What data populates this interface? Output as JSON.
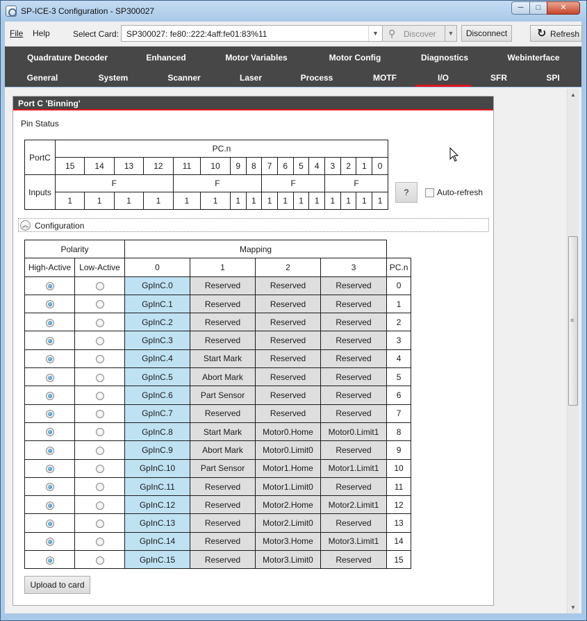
{
  "window": {
    "title": "SP-ICE-3 Configuration - SP300027",
    "minimize": "─",
    "maximize": "□",
    "close": "✕"
  },
  "menu": {
    "file": "File",
    "help": "Help"
  },
  "toolbar": {
    "select_card_label": "Select Card:",
    "card_value": "SP300027: fe80::222:4aff:fe01:83%11",
    "discover_label": "Discover",
    "disconnect_label": "Disconnect",
    "refresh_label": "Refresh"
  },
  "tabs_row1": [
    "Quadrature Decoder",
    "Enhanced",
    "Motor Variables",
    "Motor Config",
    "Diagnostics",
    "Webinterface"
  ],
  "tabs_row2": [
    "General",
    "System",
    "Scanner",
    "Laser",
    "Process",
    "MOTF",
    "I/O",
    "SFR",
    "SPI"
  ],
  "active_tab": "I/O",
  "panel": {
    "title": "Port C 'Binning'",
    "pin_status_label": "Pin Status",
    "pin_table": {
      "port_label": "PortC",
      "pc_header": "PC.n",
      "pin_numbers": [
        "15",
        "14",
        "13",
        "12",
        "11",
        "10",
        "9",
        "8",
        "7",
        "6",
        "5",
        "4",
        "3",
        "2",
        "1",
        "0"
      ],
      "inputs_label": "Inputs",
      "hex_groups": [
        "F",
        "F",
        "F",
        "F"
      ],
      "input_values": [
        "1",
        "1",
        "1",
        "1",
        "1",
        "1",
        "1",
        "1",
        "1",
        "1",
        "1",
        "1",
        "1",
        "1",
        "1",
        "1"
      ]
    },
    "help_button": "?",
    "auto_refresh_label": "Auto-refresh",
    "auto_refresh_checked": false,
    "configuration_label": "Configuration",
    "mapping_table": {
      "polarity_header": "Polarity",
      "mapping_header": "Mapping",
      "high_active": "High-Active",
      "low_active": "Low-Active",
      "map_columns": [
        "0",
        "1",
        "2",
        "3"
      ],
      "pc_header": "PC.n",
      "rows": [
        {
          "high": true,
          "m0": "GpInC.0",
          "m1": "Reserved",
          "m2": "Reserved",
          "m3": "Reserved",
          "pc": "0"
        },
        {
          "high": true,
          "m0": "GpInC.1",
          "m1": "Reserved",
          "m2": "Reserved",
          "m3": "Reserved",
          "pc": "1"
        },
        {
          "high": true,
          "m0": "GpInC.2",
          "m1": "Reserved",
          "m2": "Reserved",
          "m3": "Reserved",
          "pc": "2"
        },
        {
          "high": true,
          "m0": "GpInC.3",
          "m1": "Reserved",
          "m2": "Reserved",
          "m3": "Reserved",
          "pc": "3"
        },
        {
          "high": true,
          "m0": "GpInC.4",
          "m1": "Start Mark",
          "m2": "Reserved",
          "m3": "Reserved",
          "pc": "4"
        },
        {
          "high": true,
          "m0": "GpInC.5",
          "m1": "Abort Mark",
          "m2": "Reserved",
          "m3": "Reserved",
          "pc": "5"
        },
        {
          "high": true,
          "m0": "GpInC.6",
          "m1": "Part Sensor",
          "m2": "Reserved",
          "m3": "Reserved",
          "pc": "6"
        },
        {
          "high": true,
          "m0": "GpInC.7",
          "m1": "Reserved",
          "m2": "Reserved",
          "m3": "Reserved",
          "pc": "7"
        },
        {
          "high": true,
          "m0": "GpInC.8",
          "m1": "Start Mark",
          "m2": "Motor0.Home",
          "m3": "Motor0.Limit1",
          "pc": "8"
        },
        {
          "high": true,
          "m0": "GpInC.9",
          "m1": "Abort Mark",
          "m2": "Motor0.Limit0",
          "m3": "Reserved",
          "pc": "9"
        },
        {
          "high": true,
          "m0": "GpInC.10",
          "m1": "Part Sensor",
          "m2": "Motor1.Home",
          "m3": "Motor1.Limit1",
          "pc": "10"
        },
        {
          "high": true,
          "m0": "GpInC.11",
          "m1": "Reserved",
          "m2": "Motor1.Limit0",
          "m3": "Reserved",
          "pc": "11"
        },
        {
          "high": true,
          "m0": "GpInC.12",
          "m1": "Reserved",
          "m2": "Motor2.Home",
          "m3": "Motor2.Limit1",
          "pc": "12"
        },
        {
          "high": true,
          "m0": "GpInC.13",
          "m1": "Reserved",
          "m2": "Motor2.Limit0",
          "m3": "Reserved",
          "pc": "13"
        },
        {
          "high": true,
          "m0": "GpInC.14",
          "m1": "Reserved",
          "m2": "Motor3.Home",
          "m3": "Motor3.Limit1",
          "pc": "14"
        },
        {
          "high": true,
          "m0": "GpInC.15",
          "m1": "Reserved",
          "m2": "Motor3.Limit0",
          "m3": "Reserved",
          "pc": "15"
        }
      ]
    },
    "upload_label": "Upload to card"
  },
  "colors": {
    "tab_bg": "#474747",
    "accent": "#e0141e",
    "map0_bg": "#bfe2f3",
    "mapx_bg": "#dedede"
  }
}
